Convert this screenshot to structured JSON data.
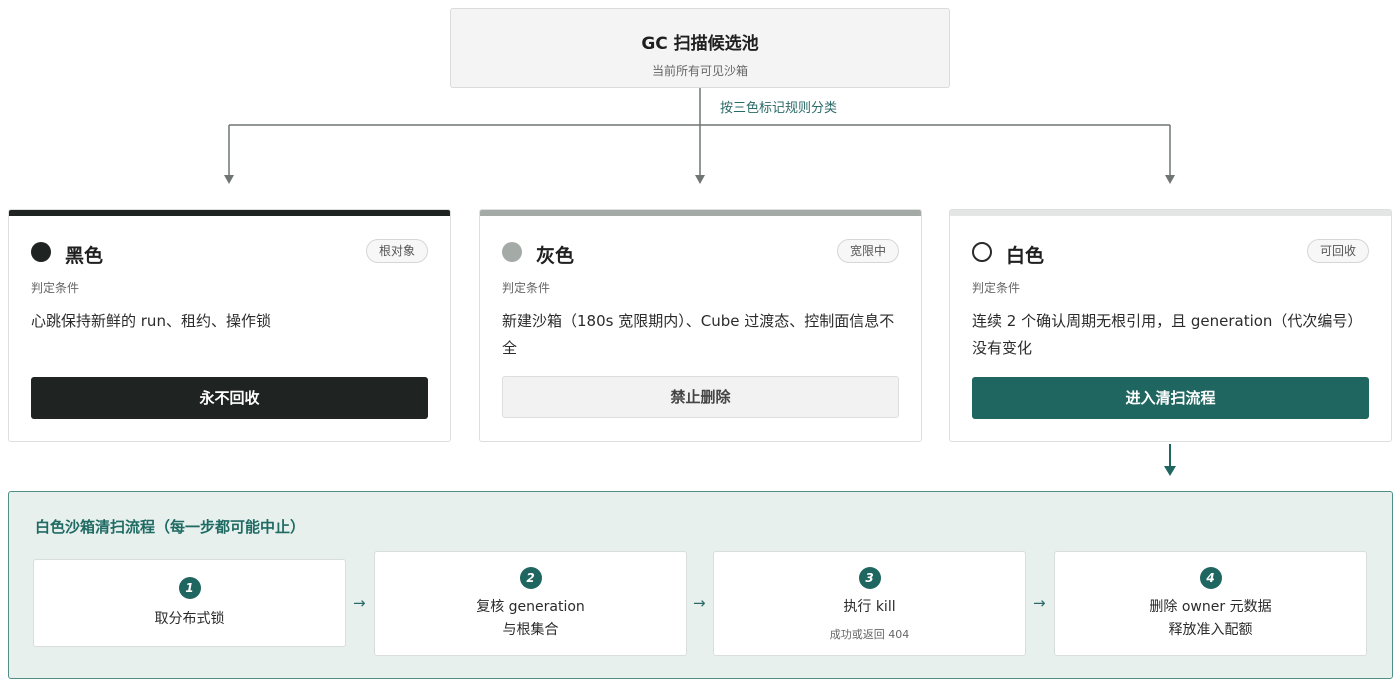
{
  "pool": {
    "title": "GC 扫描候选池",
    "subtitle": "当前所有可见沙箱"
  },
  "classify_label": "按三色标记规则分类",
  "cards": [
    {
      "title": "黑色",
      "badge": "根对象",
      "cond_label": "判定条件",
      "cond_text": "心跳保持新鲜的 run、租约、操作锁",
      "action": "永不回收",
      "strip_color": "#1f2321",
      "dot_color": "#1f2321",
      "action_bg": "#1f2321",
      "action_fg": "#ffffff"
    },
    {
      "title": "灰色",
      "badge": "宽限中",
      "cond_label": "判定条件",
      "cond_text": "新建沙箱（180s 宽限期内）、Cube 过渡态、控制面信息不全",
      "action": "禁止删除",
      "strip_color": "#a4aba7",
      "dot_color": "#a4aba7",
      "action_bg": "#f1f2f1",
      "action_fg": "#444444"
    },
    {
      "title": "白色",
      "badge": "可回收",
      "cond_label": "判定条件",
      "cond_text": "连续 2 个确认周期无根引用，且 generation（代次编号）没有变化",
      "action": "进入清扫流程",
      "strip_color": "#e3e6e4",
      "dot_color": "#ffffff",
      "action_bg": "#1f6660",
      "action_fg": "#ffffff"
    }
  ],
  "sweep": {
    "title": "白色沙箱清扫流程（每一步都可能中止）",
    "steps": [
      {
        "num": "1",
        "line1": "取分布式锁",
        "line2": "",
        "sub": ""
      },
      {
        "num": "2",
        "line1": "复核 generation",
        "line2": "与根集合",
        "sub": ""
      },
      {
        "num": "3",
        "line1": "执行 kill",
        "line2": "",
        "sub": "成功或返回 404"
      },
      {
        "num": "4",
        "line1": "删除 owner 元数据",
        "line2": "释放准入配额",
        "sub": ""
      }
    ],
    "arrow": "→"
  },
  "colors": {
    "accent": "#1f6660",
    "line": "#6e7572",
    "flow_bg": "#e8f0ee"
  }
}
